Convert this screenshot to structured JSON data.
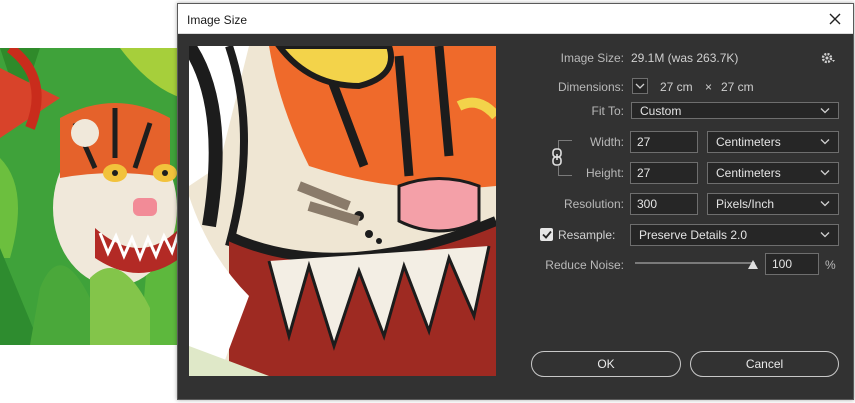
{
  "dialog": {
    "title": "Image Size"
  },
  "info": {
    "image_size_label": "Image Size:",
    "image_size_value": "29.1M (was 263.7K)",
    "dimensions_label": "Dimensions:",
    "dimensions_w": "27 cm",
    "dimensions_sep": "×",
    "dimensions_h": "27 cm"
  },
  "fit_to": {
    "label": "Fit To:",
    "value": "Custom"
  },
  "width": {
    "label": "Width:",
    "value": "27",
    "unit": "Centimeters"
  },
  "height": {
    "label": "Height:",
    "value": "27",
    "unit": "Centimeters"
  },
  "resolution": {
    "label": "Resolution:",
    "value": "300",
    "unit": "Pixels/Inch"
  },
  "resample": {
    "label": "Resample:",
    "checked": true,
    "value": "Preserve Details 2.0"
  },
  "reduce_noise": {
    "label": "Reduce Noise:",
    "value": "100",
    "unit": "%",
    "level_percent": 100
  },
  "buttons": {
    "ok": "OK",
    "cancel": "Cancel"
  },
  "icons": [
    "gear-icon",
    "close-icon",
    "chevron-down-icon",
    "link-icon",
    "checkmark-icon"
  ],
  "colors": {
    "dialog_bg": "#323232",
    "field_bg": "#262626",
    "label": "#b9b9b9"
  }
}
